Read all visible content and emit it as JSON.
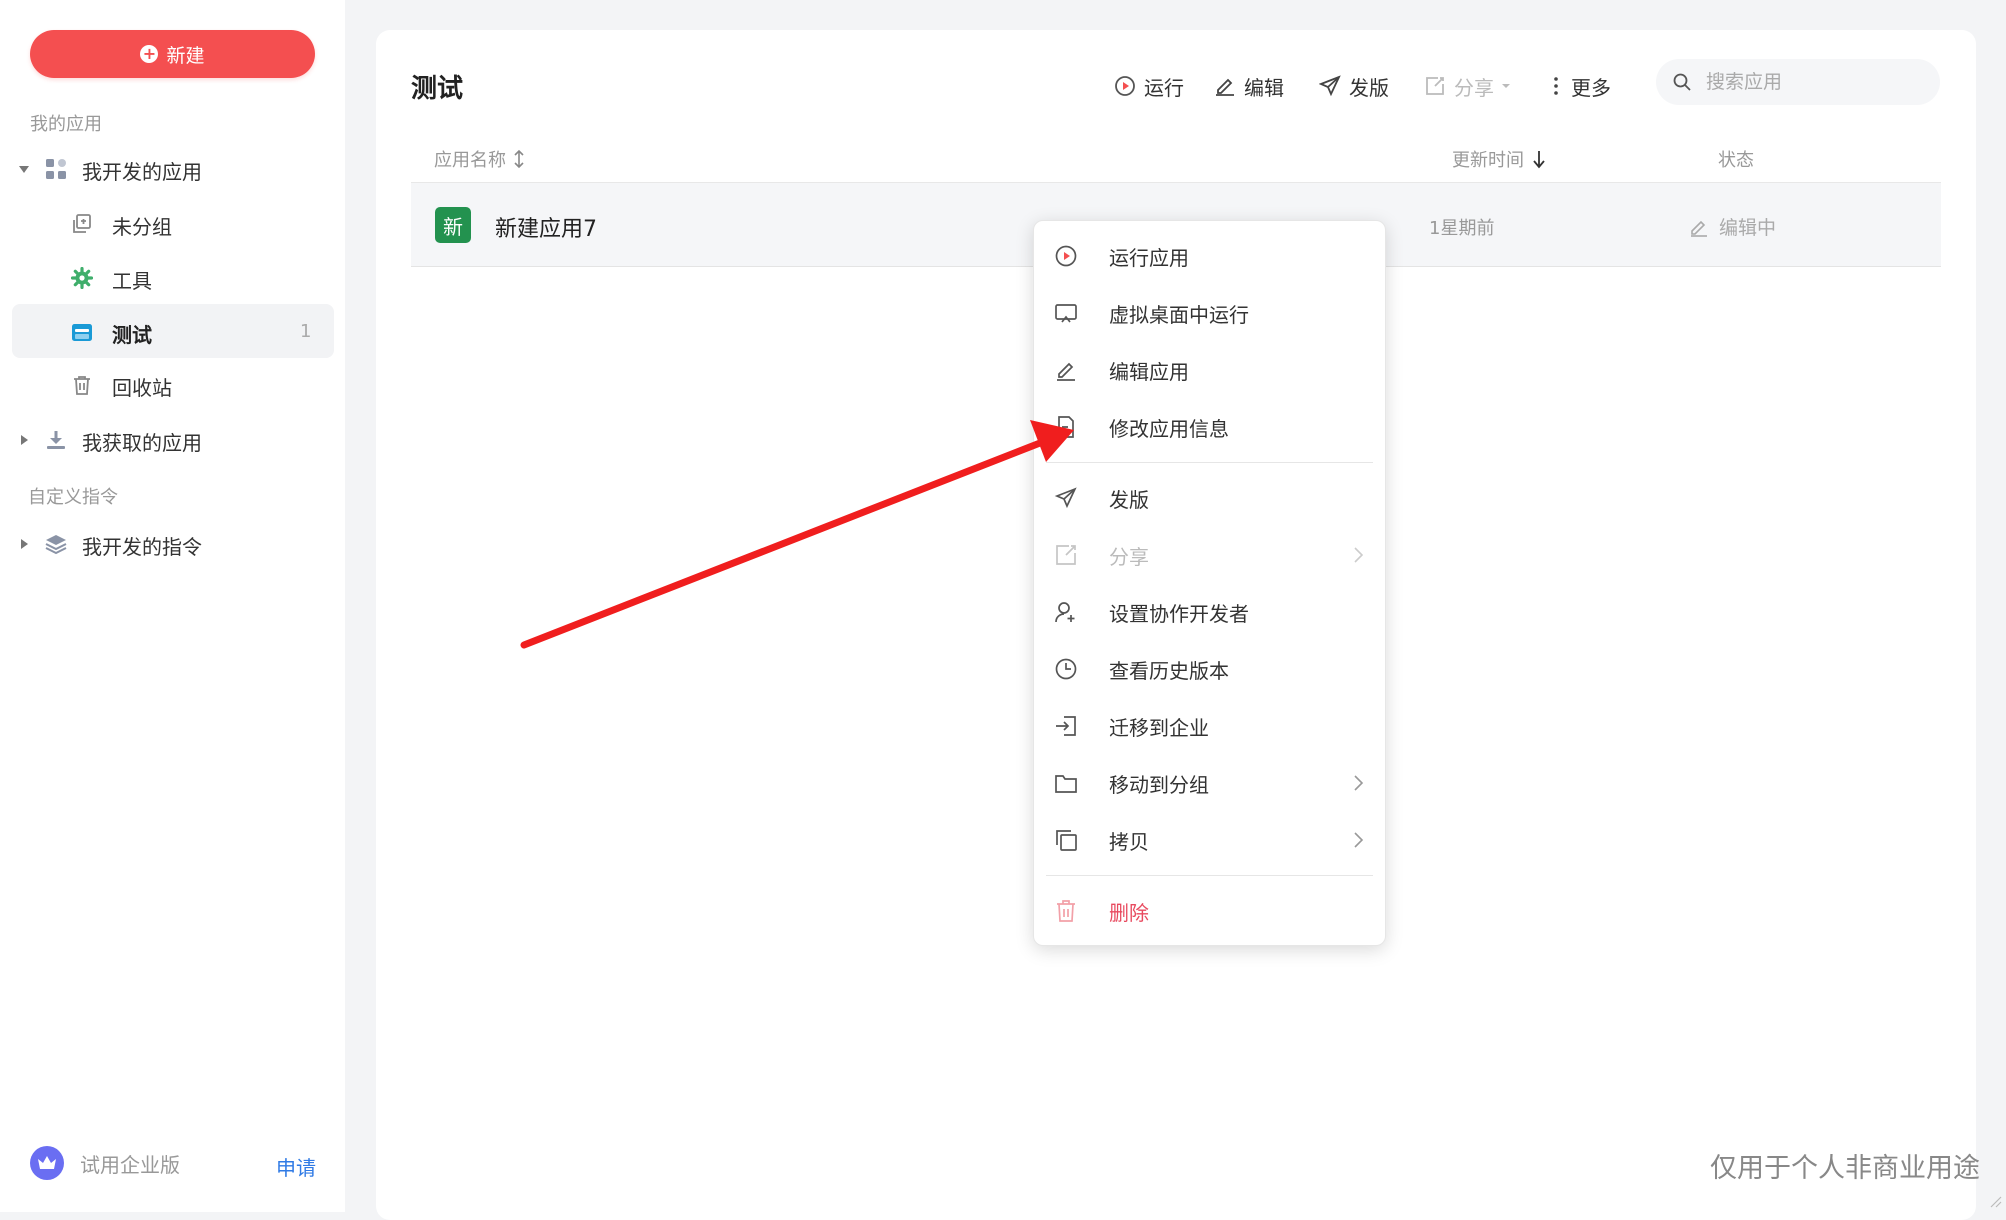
{
  "sidebar": {
    "new_button": "新建",
    "my_apps_section": "我的应用",
    "developed_apps": "我开发的应用",
    "groups": [
      {
        "label": "未分组"
      },
      {
        "label": "工具"
      },
      {
        "label": "测试",
        "count": "1"
      },
      {
        "label": "回收站"
      }
    ],
    "acquired_apps": "我获取的应用",
    "custom_commands_section": "自定义指令",
    "developed_commands": "我开发的指令",
    "trial_label": "试用企业版",
    "apply_label": "申请"
  },
  "main": {
    "title": "测试",
    "toolbar": {
      "run": "运行",
      "edit": "编辑",
      "publish": "发版",
      "share": "分享",
      "more": "更多"
    },
    "search": {
      "placeholder": "搜索应用"
    },
    "table": {
      "columns": [
        "应用名称",
        "更新时间",
        "状态"
      ],
      "rows": [
        {
          "icon_text": "新",
          "name": "新建应用7",
          "updated": "1星期前",
          "status": "编辑中"
        }
      ]
    }
  },
  "context_menu": {
    "items": [
      {
        "label": "运行应用",
        "icon": "play-circle-icon"
      },
      {
        "label": "虚拟桌面中运行",
        "icon": "monitor-icon"
      },
      {
        "label": "编辑应用",
        "icon": "pencil-icon"
      },
      {
        "label": "修改应用信息",
        "icon": "edit-doc-icon"
      },
      {
        "label": "发版",
        "icon": "send-icon"
      },
      {
        "label": "分享",
        "icon": "share-icon",
        "disabled": true
      },
      {
        "label": "设置协作开发者",
        "icon": "user-add-icon"
      },
      {
        "label": "查看历史版本",
        "icon": "clock-icon"
      },
      {
        "label": "迁移到企业",
        "icon": "login-icon"
      },
      {
        "label": "移动到分组",
        "icon": "folder-icon"
      },
      {
        "label": "拷贝",
        "icon": "copy-icon"
      },
      {
        "label": "删除",
        "icon": "trash-icon",
        "danger": true
      }
    ]
  },
  "watermark": "仅用于个人非商业用途",
  "colors": {
    "primary_red": "#f44f50",
    "app_icon_green": "#23924f",
    "link_blue": "#2f7ae5",
    "danger": "#e84a5f",
    "annotation_arrow": "#f01e1e"
  }
}
